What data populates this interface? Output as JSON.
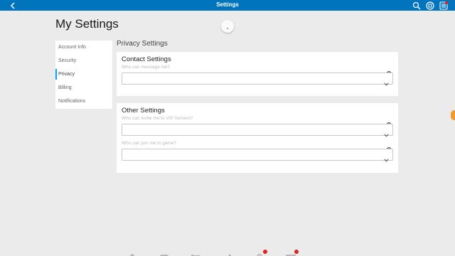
{
  "topbar": {
    "title": "Settings",
    "icons": [
      "back-arrow-icon",
      "search-icon",
      "robux-icon",
      "menu-icon"
    ]
  },
  "page": {
    "title": "My Settings"
  },
  "sidebar": {
    "items": [
      {
        "label": "Account Info",
        "active": false
      },
      {
        "label": "Security",
        "active": false
      },
      {
        "label": "Privacy",
        "active": true
      },
      {
        "label": "Billing",
        "active": false
      },
      {
        "label": "Notifications",
        "active": false
      }
    ]
  },
  "privacy": {
    "heading": "Privacy Settings",
    "contact": {
      "title": "Contact Settings",
      "message_label": "Who can message me?",
      "message_value": ""
    },
    "other": {
      "title": "Other Settings",
      "vip_label": "Who can invite me to VIP Servers?",
      "vip_value": "",
      "join_label": "Who can join me in game?",
      "join_value": ""
    }
  },
  "bottombar": {
    "icons": [
      "home-icon",
      "games-icon",
      "catalog-icon",
      "avatar-icon",
      "friends-icon",
      "messages-icon",
      "more-icon"
    ]
  },
  "colors": {
    "accent": "#0074bd",
    "background": "#ebebeb",
    "active_indicator": "#00a2ff"
  }
}
